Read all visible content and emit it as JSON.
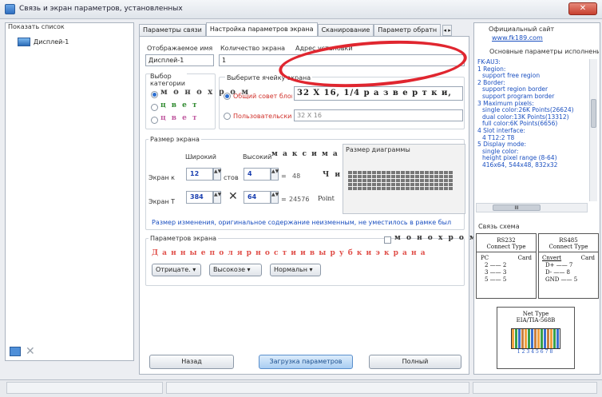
{
  "window": {
    "title": "Связь и экран параметров, установленных",
    "close_label": "✕"
  },
  "left": {
    "title": "Показать список",
    "tree_item": "Дисплей-1"
  },
  "tabs": [
    "Параметры связи",
    "Настройка параметров экрана",
    "Сканирование",
    "Параметр обратн"
  ],
  "tab_arrows": "◂ ▸",
  "form": {
    "display_name_label": "Отображаемое имя",
    "screen_count_label": "Количество экрана",
    "address_label": "Адрес установки",
    "display_name_value": "Дисплей-1",
    "screen_count_value": "1",
    "choose_label": "Выбор категории",
    "mono_label": "м о н о х р о м",
    "color_label": "ц в е т",
    "color2_label": "ц в е т",
    "cell_type_label": "Выберите ячейку экрана",
    "shared_label": "Общий совет блок",
    "custom_label": "Пользовательские",
    "cell_value": "32 X 16, 1/4  р а з в е р т к и,",
    "custom_value": "32 X 16"
  },
  "size": {
    "title": "Размер экрана",
    "width_label": "Широкий",
    "height_label": "Высокий",
    "max_label": "м а к с и м а л ь н а я",
    "preview_label": "Размер диаграммы",
    "row1_label": "Экран к",
    "row1_w": "12",
    "row1_unit": "стов",
    "row1_h": "4",
    "row1_eq": "=",
    "row1_result": "48",
    "row1_tail": "Ч и",
    "row2_label": "Экран Т",
    "row2_w": "384",
    "row2_x": "✕",
    "row2_h": "64",
    "row2_eq": "=",
    "row2_result": "24576",
    "row2_tail": "Point",
    "notice": "Размер изменения, оригинальное содержание неизменным, не уместилось в рамке был"
  },
  "params": {
    "title": "Параметров экрана",
    "mono_chk": "м о н о х р о м и т",
    "polarity": "Д а н н ы е  п о л я р н о с т и  и  в ы р у б к и  э к р а н а",
    "drop1": "Отрицате. ▾",
    "drop2": "Высокозе ▾",
    "drop3": "Нормальн ▾"
  },
  "buttons": {
    "back": "Назад",
    "load": "Загрузка параметров",
    "finish": "Полный"
  },
  "right": {
    "site_label": "Официальный сайт",
    "site_url": "www.fk189.com",
    "params_head": "Основные параметры исполнения к",
    "lines": [
      "FK-AU3:",
      "1 Region:",
      "  support free region",
      "2 Border:",
      "  support region border",
      "  support program border",
      "3 Maximum pixels:",
      "  single color:26K Points(26624)",
      "  dual color:13K Points(13312)",
      "  full color:6K Points(6656)",
      "4 Slot interface:",
      "  4 T12:2 T8",
      "5 Display mode:",
      "  single color:",
      "  height pixel range (8-64)",
      "  416x64, 544x48, 832x32"
    ],
    "scroll_mid": "III",
    "schema_label": "Связь схема",
    "rs232": {
      "title": "RS232",
      "sub": "Connect Type",
      "pc": "PC",
      "card": "Card",
      "rows": [
        "2  ——  2",
        "3  ——  3",
        "5  ——  5"
      ]
    },
    "rs485": {
      "title": "RS485",
      "sub": "Connect Type",
      "left": "Cnvert",
      "card": "Card",
      "rows": [
        "D+ —— 7",
        "D- —— 8",
        "GND —— 5"
      ]
    },
    "net": {
      "title": "Net Type",
      "sub": "EIA/TIA-568B",
      "pins": "12345678"
    }
  },
  "colors": {
    "accent_red": "#e0262f",
    "link_blue": "#1a4fc0"
  }
}
